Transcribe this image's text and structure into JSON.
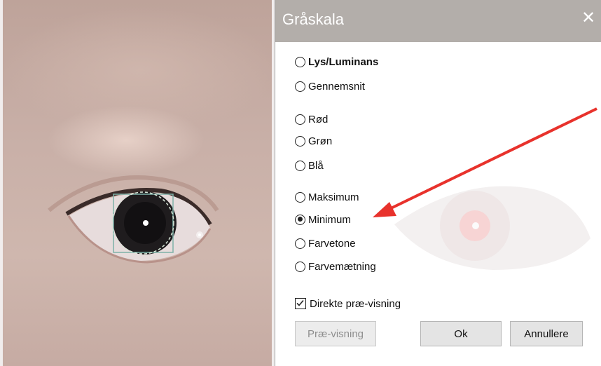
{
  "dialog": {
    "title": "Gråskala",
    "close_glyph": "✕",
    "options": [
      {
        "label": "Lys/Luminans",
        "checked": false,
        "bold": true
      },
      {
        "label": "Gennemsnit",
        "checked": false
      },
      {
        "label": "Rød",
        "checked": false
      },
      {
        "label": "Grøn",
        "checked": false
      },
      {
        "label": "Blå",
        "checked": false
      },
      {
        "label": "Maksimum",
        "checked": false
      },
      {
        "label": "Minimum",
        "checked": true
      },
      {
        "label": "Farvetone",
        "checked": false
      },
      {
        "label": "Farvemætning",
        "checked": false
      }
    ],
    "direct_preview": {
      "label": "Direkte præ-visning",
      "checked": true
    },
    "buttons": {
      "preview": "Præ-visning",
      "ok": "Ok",
      "cancel": "Annullere"
    }
  },
  "colors": {
    "titlebar": "#b3aeaa",
    "annotation_arrow": "#e8322c"
  }
}
